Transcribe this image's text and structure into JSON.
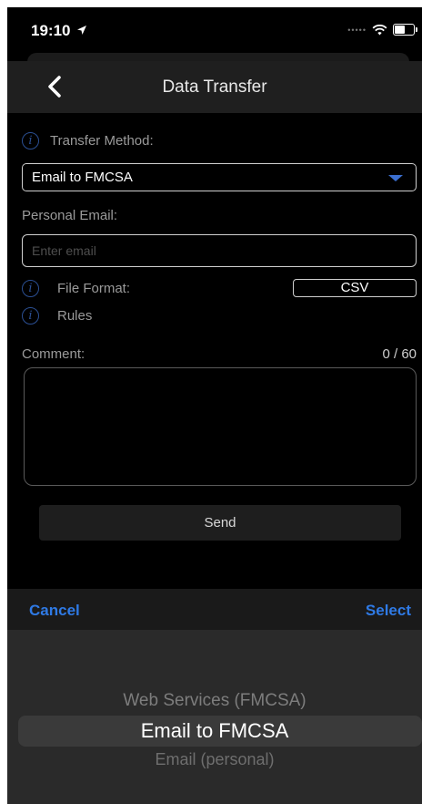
{
  "status_bar": {
    "time": "19:10",
    "battery_level": 0.6
  },
  "nav": {
    "title": "Data Transfer",
    "back_icon": "chevron-left-icon"
  },
  "form": {
    "transfer_method_label": "Transfer Method:",
    "transfer_method_value": "Email to FMCSA",
    "personal_email_label": "Personal Email:",
    "email_placeholder": "Enter email",
    "file_format_label": "File Format:",
    "file_format_value": "CSV",
    "rules_label": "Rules",
    "comment_label": "Comment:",
    "comment_count": "0 / 60",
    "send_label": "Send"
  },
  "picker": {
    "cancel_label": "Cancel",
    "select_label": "Select",
    "options": [
      "Web Services (FMCSA)",
      "Email to FMCSA",
      "Email (personal)"
    ],
    "selected": "Email to FMCSA"
  },
  "colors": {
    "accent": "#2f7ae5",
    "info_icon": "#2b4f93",
    "background": "#000000"
  }
}
